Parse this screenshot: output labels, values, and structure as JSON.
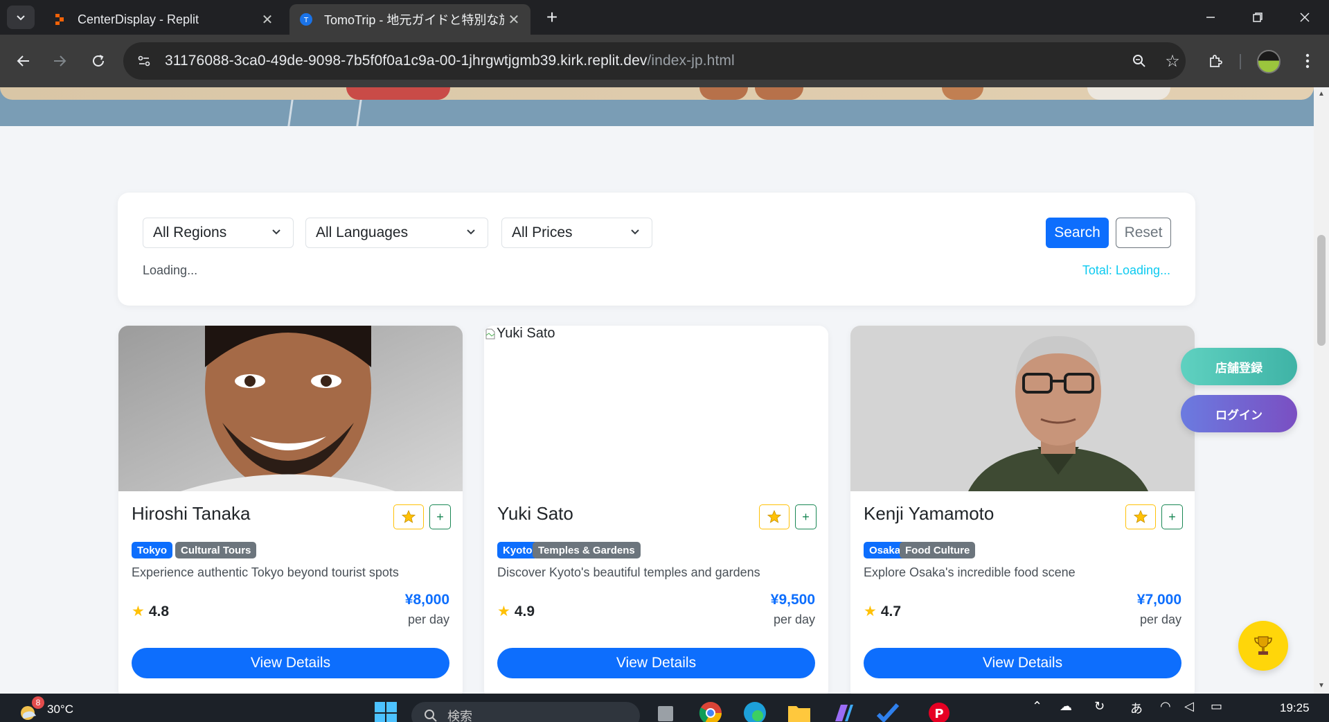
{
  "browser": {
    "tabs": [
      {
        "title": "CenterDisplay - Replit",
        "favicon": "replit-icon",
        "active": false
      },
      {
        "title": "TomoTrip - 地元ガイドと特別な旅",
        "favicon": "tomotrip-icon",
        "active": true
      }
    ],
    "url_host": "31176088-3ca0-49de-9098-7b5f0f0a1c9a-00-1jhrgwtjgmb39.kirk.replit.dev",
    "url_path": "/index-jp.html"
  },
  "filters": {
    "region": "All Regions",
    "language": "All Languages",
    "price": "All Prices",
    "search_label": "Search",
    "reset_label": "Reset",
    "status": "Loading...",
    "total": "Total: Loading..."
  },
  "guides": [
    {
      "name": "Hiroshi Tanaka",
      "region": "Tokyo",
      "category": "Cultural Tours",
      "description": "Experience authentic Tokyo beyond tourist spots",
      "rating": "4.8",
      "price": "¥8,000",
      "per": "per day",
      "button": "View Details",
      "photo_alt": ""
    },
    {
      "name": "Yuki Sato",
      "region": "Kyoto",
      "category": "Temples & Gardens",
      "description": "Discover Kyoto's beautiful temples and gardens",
      "rating": "4.9",
      "price": "¥9,500",
      "per": "per day",
      "button": "View Details",
      "photo_alt": "Yuki Sato"
    },
    {
      "name": "Kenji Yamamoto",
      "region": "Osaka",
      "category": "Food Culture",
      "description": "Explore Osaka's incredible food scene",
      "rating": "4.7",
      "price": "¥7,000",
      "per": "per day",
      "button": "View Details",
      "photo_alt": ""
    }
  ],
  "floating": {
    "store_register": "店舗登録",
    "login": "ログイン"
  },
  "taskbar": {
    "weather_temp": "30°C",
    "weather_badge": "8",
    "search_placeholder": "検索",
    "ime": "あ",
    "time": "19:25"
  },
  "colors": {
    "primary": "#0d6efd",
    "accent_teal": "#3fb3a6",
    "accent_purple": "#7a4fc2",
    "star": "#ffc107"
  }
}
